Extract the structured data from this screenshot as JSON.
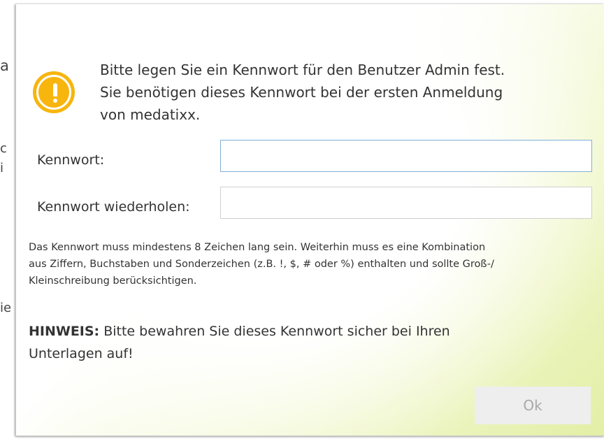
{
  "background": {
    "fragments": [
      "a",
      "c",
      "i",
      "ie"
    ]
  },
  "dialog": {
    "icon": "warning-icon",
    "message_lines": [
      "Bitte legen Sie ein Kennwort für den Benutzer Admin fest.",
      "Sie benötigen dieses Kennwort bei der ersten Anmeldung",
      "von medatixx."
    ],
    "password": {
      "label": "Kennwort:",
      "value": ""
    },
    "password_repeat": {
      "label": "Kennwort wiederholen:",
      "value": ""
    },
    "hint_lines": [
      "Das Kennwort muss mindestens 8 Zeichen lang sein. Weiterhin muss es eine Kombination",
      "aus Ziffern, Buchstaben und Sonderzeichen (z.B. !, $, # oder %) enthalten und sollte Groß-/",
      "Kleinschreibung berücksichtigen."
    ],
    "note": {
      "prefix": "HINWEIS:",
      "line1": " Bitte bewahren Sie dieses Kennwort sicher bei Ihren",
      "line2": "Unterlagen auf!"
    },
    "ok_label": "Ok"
  },
  "colors": {
    "warning": "#f7b50e",
    "focus_border": "#7fb0d8",
    "button_disabled_bg": "#eeeeee",
    "button_disabled_text": "#a8a8a8"
  }
}
